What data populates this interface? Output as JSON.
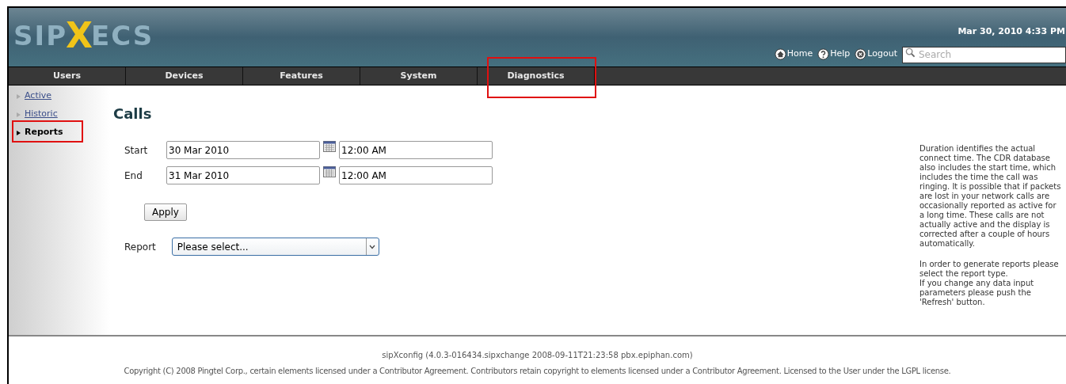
{
  "header": {
    "logo": {
      "part_1": "SIP",
      "part_2": "X",
      "part_3": "ECS"
    },
    "datetime": "Mar 30, 2010 4:33 PM",
    "links": [
      {
        "kind": "home",
        "label": "Home"
      },
      {
        "kind": "help",
        "label": "Help"
      },
      {
        "kind": "logout",
        "label": "Logout"
      }
    ],
    "search": {
      "placeholder": "Search"
    }
  },
  "nav": [
    {
      "label": "Users",
      "highlighted": false
    },
    {
      "label": "Devices",
      "highlighted": false
    },
    {
      "label": "Features",
      "highlighted": false
    },
    {
      "label": "System",
      "highlighted": false
    },
    {
      "label": "Diagnostics",
      "highlighted": true
    }
  ],
  "sidebar": {
    "items": [
      {
        "label": "Active",
        "selected": false,
        "highlighted": false
      },
      {
        "label": "Historic",
        "selected": false,
        "highlighted": false
      },
      {
        "label": "Reports",
        "selected": true,
        "highlighted": true
      }
    ]
  },
  "page": {
    "title": "Calls",
    "rows": [
      {
        "label": "Start",
        "date": "30 Mar 2010",
        "time": "12:00 AM"
      },
      {
        "label": "End",
        "date": "31 Mar 2010",
        "time": "12:00 AM"
      }
    ],
    "apply_button": "Apply",
    "report": {
      "label": "Report",
      "value": "Please select..."
    }
  },
  "help": [
    "Duration identifies the actual connect time. The CDR database also includes the start time, which includes the time the call was ringing. It is possible that if packets are lost in your network calls are occasionally reported as active for a long time. These calls are not actually active and the display is corrected after a couple of hours automatically.",
    "In order to generate reports please select the report type.",
    "If you change any data input parameters please push the 'Refresh' button."
  ],
  "footer": {
    "version": "sipXconfig (4.0.3-016434.sipxchange 2008-09-11T21:23:58 pbx.epiphan.com)",
    "copyright": "Copyright (C) 2008 Pingtel Corp., certain elements licensed under a Contributor Agreement. Contributors retain copyright to elements licensed under a Contributor Agreement. Licensed to the User under the LGPL license."
  }
}
